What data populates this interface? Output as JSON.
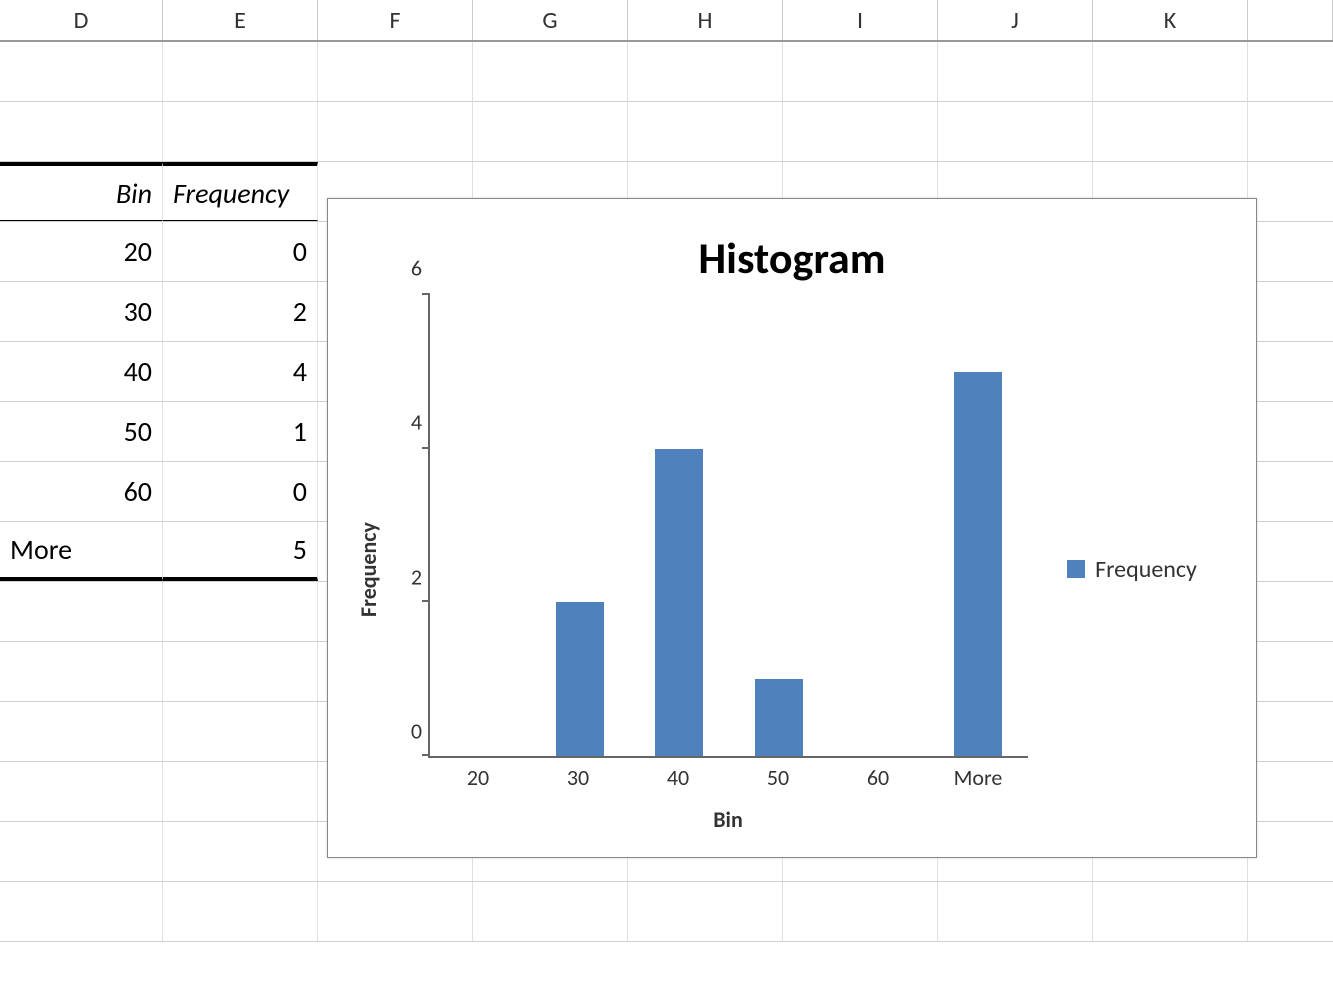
{
  "columns": [
    "D",
    "E",
    "F",
    "G",
    "H",
    "I",
    "J",
    "K"
  ],
  "table": {
    "headers": {
      "bin": "Bin",
      "freq": "Frequency"
    },
    "rows": [
      {
        "bin": "20",
        "freq": "0"
      },
      {
        "bin": "30",
        "freq": "2"
      },
      {
        "bin": "40",
        "freq": "4"
      },
      {
        "bin": "50",
        "freq": "1"
      },
      {
        "bin": "60",
        "freq": "0"
      },
      {
        "bin": "More",
        "freq": "5"
      }
    ]
  },
  "chart_data": {
    "type": "bar",
    "title": "Histogram",
    "xlabel": "Bin",
    "ylabel": "Frequency",
    "categories": [
      "20",
      "30",
      "40",
      "50",
      "60",
      "More"
    ],
    "values": [
      0,
      2,
      4,
      1,
      0,
      5
    ],
    "series": [
      {
        "name": "Frequency",
        "values": [
          0,
          2,
          4,
          1,
          0,
          5
        ]
      }
    ],
    "ylim": [
      0,
      6
    ],
    "yticks": [
      0,
      2,
      4,
      6
    ],
    "legend": [
      "Frequency"
    ],
    "bar_color": "#4f81bd"
  }
}
